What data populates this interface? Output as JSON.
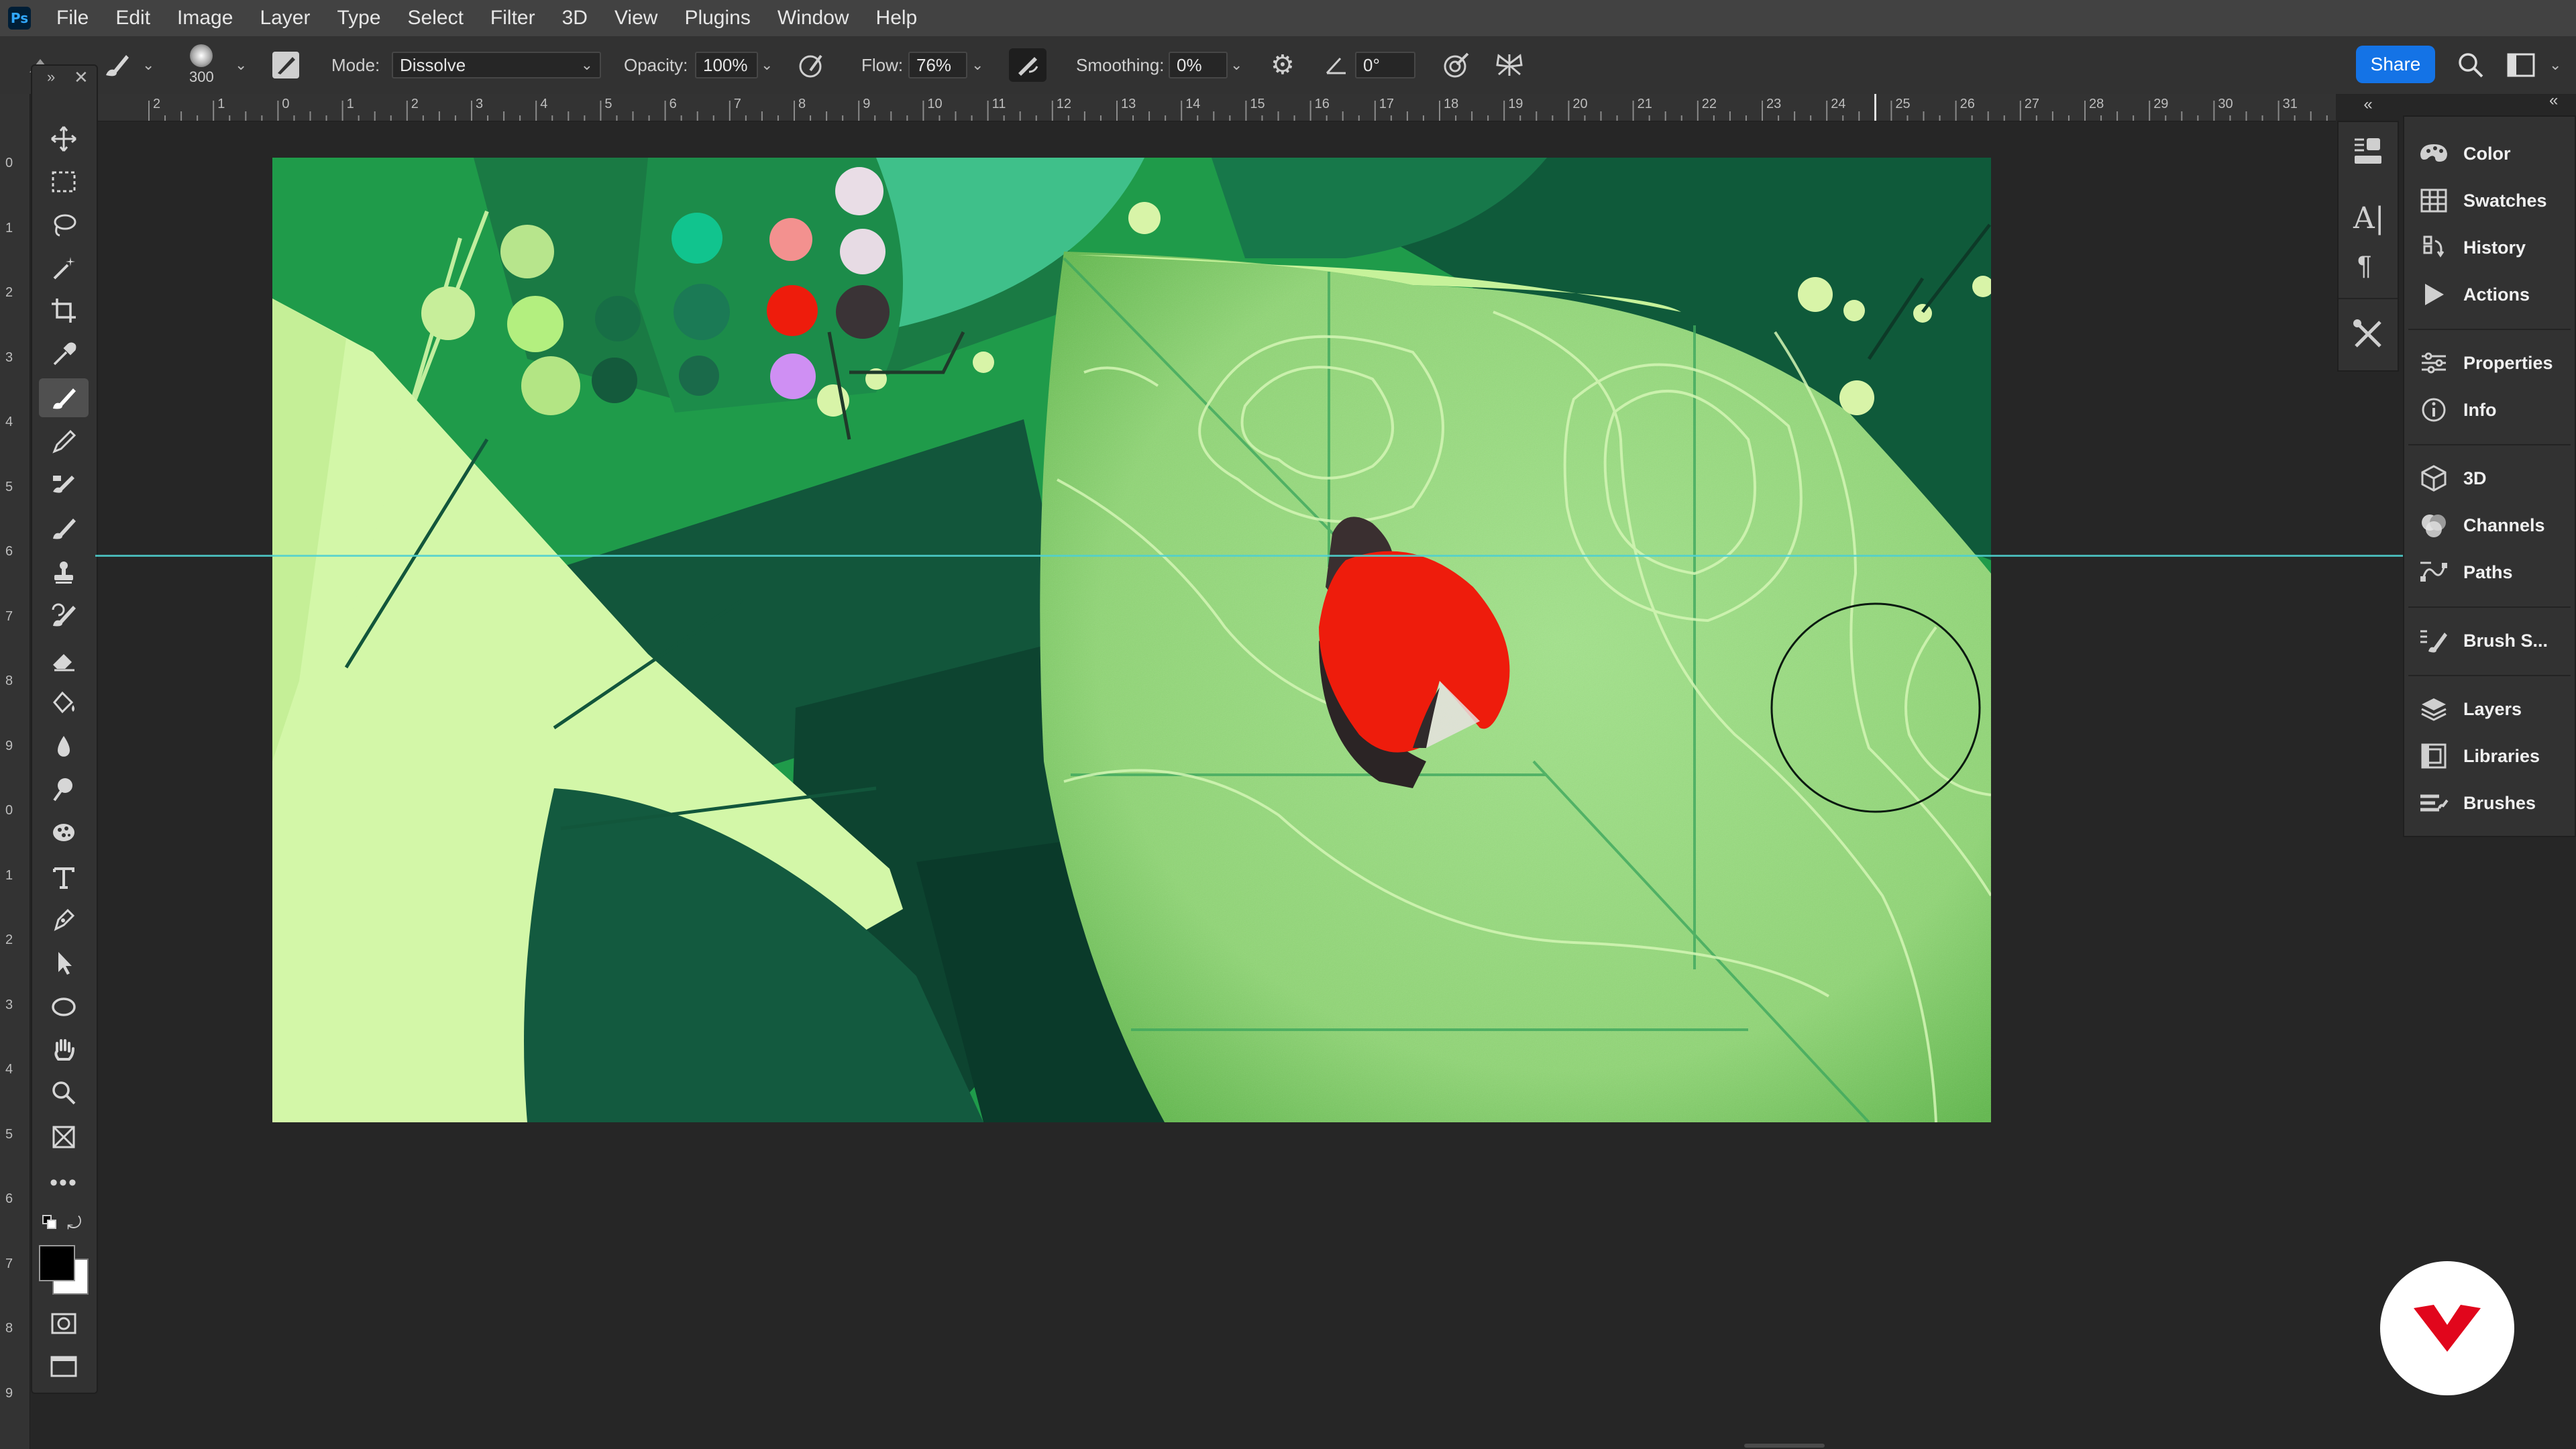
{
  "app": {
    "logo_text": "Ps"
  },
  "menu": [
    "File",
    "Edit",
    "Image",
    "Layer",
    "Type",
    "Select",
    "Filter",
    "3D",
    "View",
    "Plugins",
    "Window",
    "Help"
  ],
  "options": {
    "brush_size": "300",
    "mode_label": "Mode:",
    "mode_value": "Dissolve",
    "opacity_label": "Opacity:",
    "opacity_value": "100%",
    "flow_label": "Flow:",
    "flow_value": "76%",
    "smoothing_label": "Smoothing:",
    "smoothing_value": "0%",
    "angle_value": "0°",
    "share_label": "Share"
  },
  "ruler_top": [
    "2",
    "1",
    "0",
    "1",
    "2",
    "3",
    "4",
    "5",
    "6",
    "7",
    "8",
    "9",
    "10",
    "11",
    "12",
    "13",
    "14",
    "15",
    "16",
    "17",
    "18",
    "19",
    "20",
    "21",
    "22",
    "23",
    "24",
    "25",
    "26",
    "27",
    "28",
    "29",
    "30",
    "31"
  ],
  "ruler_left": [
    "0",
    "1",
    "2",
    "3",
    "4",
    "5",
    "6",
    "7",
    "8",
    "9",
    "0",
    "1",
    "2",
    "3",
    "4",
    "5",
    "6",
    "7",
    "8",
    "9"
  ],
  "panels": {
    "group1": [
      "Color",
      "Swatches",
      "History",
      "Actions"
    ],
    "group2": [
      "Properties",
      "Info"
    ],
    "group3": [
      "3D",
      "Channels",
      "Paths"
    ],
    "group4": [
      "Brush S..."
    ],
    "group5": [
      "Layers",
      "Libraries",
      "Brushes"
    ]
  },
  "colors": {
    "accent": "#1473e6",
    "guide": "#4fd0cf",
    "ladybug": "#ee1c0c",
    "leaf_light": "#8fd674",
    "pale_green": "#d3f7a8",
    "dark_green": "#0e4a34",
    "brand": "#e1061c"
  }
}
